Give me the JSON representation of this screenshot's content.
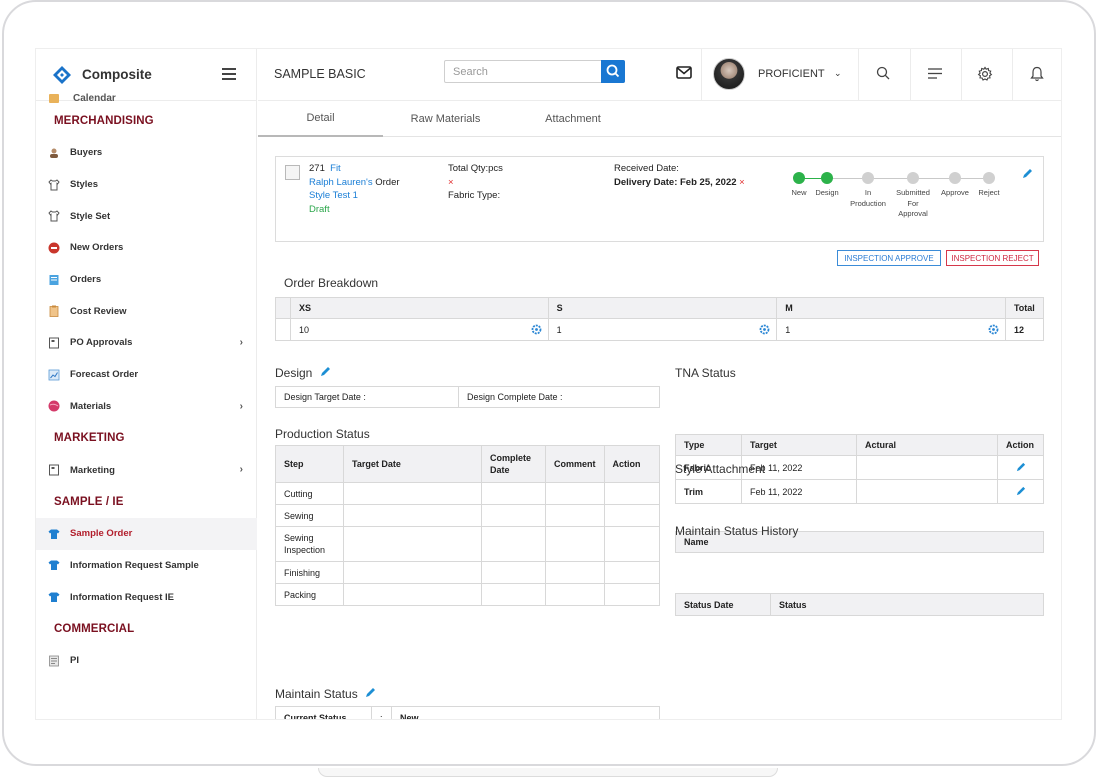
{
  "app": {
    "name": "Composite"
  },
  "sidebar": {
    "partial_item": "Calendar",
    "sections": [
      {
        "title": "MERCHANDISING",
        "items": [
          {
            "label": "Buyers",
            "icon": "user-icon"
          },
          {
            "label": "Styles",
            "icon": "shirt-icon"
          },
          {
            "label": "Style Set",
            "icon": "shirt-icon"
          },
          {
            "label": "New Orders",
            "icon": "new-orders-icon"
          },
          {
            "label": "Orders",
            "icon": "orders-icon"
          },
          {
            "label": "Cost Review",
            "icon": "clipboard-icon"
          },
          {
            "label": "PO Approvals",
            "icon": "document-icon",
            "submenu": true
          },
          {
            "label": "Forecast Order",
            "icon": "chart-icon"
          },
          {
            "label": "Materials",
            "icon": "yarn-icon",
            "submenu": true
          }
        ]
      },
      {
        "title": "MARKETING",
        "items": [
          {
            "label": "Marketing",
            "icon": "document-icon",
            "submenu": true
          }
        ]
      },
      {
        "title": "SAMPLE / IE",
        "items": [
          {
            "label": "Sample Order",
            "icon": "tshirt-icon",
            "active": true
          },
          {
            "label": "Information Request Sample",
            "icon": "tshirt-icon"
          },
          {
            "label": "Information Request IE",
            "icon": "tshirt-icon"
          }
        ]
      },
      {
        "title": "COMMERCIAL",
        "items": [
          {
            "label": "PI",
            "icon": "invoice-icon"
          }
        ]
      }
    ]
  },
  "header": {
    "page_title": "SAMPLE BASIC",
    "search_placeholder": "Search",
    "user_name": "PROFICIENT"
  },
  "tabs": [
    "Detail",
    "Raw Materials",
    "Attachment"
  ],
  "summary": {
    "order_no": "271",
    "fit": "Fit",
    "buyer": "Ralph Lauren's",
    "buyer_suffix": "Order",
    "style": "Style Test 1",
    "status": "Draft",
    "total_qty_label": "Total Qty:pcs",
    "fabric_type_label": "Fabric Type:",
    "received_date_label": "Received Date:",
    "delivery_date": "Delivery Date: Feb 25, 2022",
    "clear_mark": "×",
    "steps": [
      "New",
      "Design",
      "In Production",
      "Submitted For Approval",
      "Approve",
      "Reject"
    ],
    "steps_completed": 2
  },
  "buttons": {
    "approve": "INSPECTION APPROVE",
    "reject": "INSPECTION REJECT"
  },
  "order_breakdown": {
    "title": "Order Breakdown",
    "columns": [
      "XS",
      "S",
      "M",
      "Total"
    ],
    "values": [
      "10",
      "1",
      "1",
      "12"
    ]
  },
  "design": {
    "title": "Design",
    "target_label": "Design Target Date :",
    "complete_label": "Design Complete Date :"
  },
  "production": {
    "title": "Production Status",
    "columns": [
      "Step",
      "Target Date",
      "Complete Date",
      "Comment",
      "Action"
    ],
    "rows": [
      "Cutting",
      "Sewing",
      "Sewing Inspection",
      "Finishing",
      "Packing"
    ]
  },
  "maintain_status": {
    "title": "Maintain Status",
    "label": "Current Status",
    "colon": ":",
    "value": "New"
  },
  "tna": {
    "title": "TNA Status",
    "columns": [
      "Type",
      "Target",
      "Actural",
      "Action"
    ],
    "rows": [
      {
        "type": "Fabric",
        "target": "Feb 11, 2022"
      },
      {
        "type": "Trim",
        "target": "Feb 11, 2022"
      }
    ]
  },
  "style_attachment": {
    "title": "Style Attachment",
    "column": "Name"
  },
  "status_history": {
    "title": "Maintain Status History",
    "columns": [
      "Status Date",
      "Status"
    ]
  },
  "colors": {
    "accent": "#1977d2",
    "active_text": "#b21e2c",
    "section": "#7a1020",
    "success": "#2cb24a"
  }
}
